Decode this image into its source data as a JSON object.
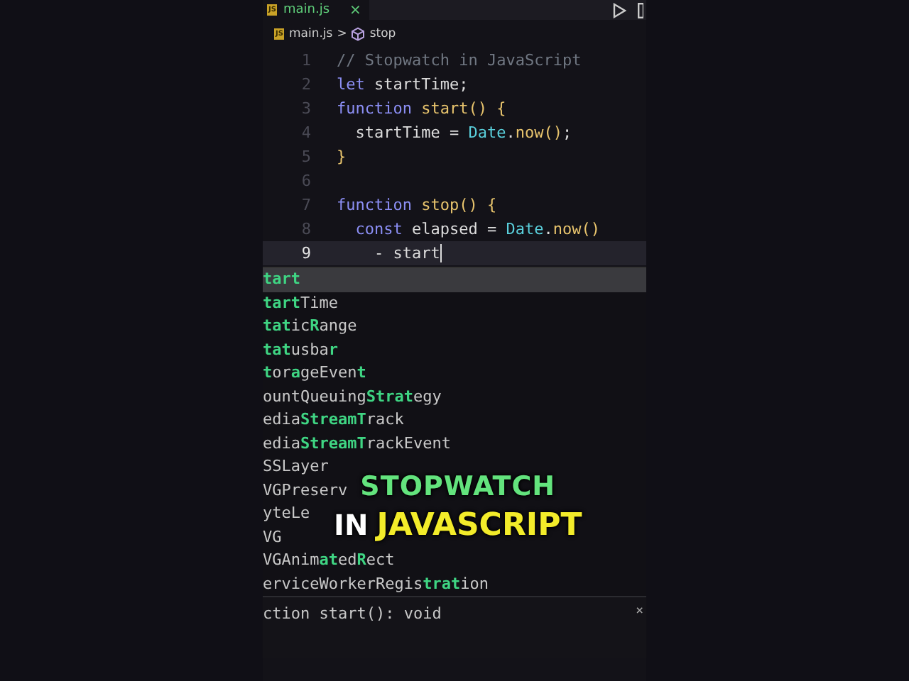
{
  "tab": {
    "filename": "main.js",
    "badge": "JS",
    "close": "×",
    "selected": true
  },
  "breadcrumb": {
    "file": "main.js",
    "badge": "JS",
    "separator": ">",
    "symbol": "stop"
  },
  "code_lines": [
    {
      "number": "1",
      "current": false,
      "tokens": [
        {
          "kind": "comment",
          "text": "// Stopwatch in JavaScript"
        }
      ]
    },
    {
      "number": "2",
      "current": false,
      "tokens": [
        {
          "kind": "keyword",
          "text": "let"
        },
        {
          "kind": "plain",
          "text": " startTime;"
        }
      ]
    },
    {
      "number": "3",
      "current": false,
      "tokens": [
        {
          "kind": "keyword",
          "text": "function"
        },
        {
          "kind": "function",
          "text": " start"
        },
        {
          "kind": "bracket",
          "text": "() {"
        }
      ]
    },
    {
      "number": "4",
      "current": false,
      "tokens": [
        {
          "kind": "plain",
          "text": "  startTime = "
        },
        {
          "kind": "class",
          "text": "Date"
        },
        {
          "kind": "plain",
          "text": "."
        },
        {
          "kind": "function",
          "text": "now"
        },
        {
          "kind": "bracket",
          "text": "()"
        },
        {
          "kind": "plain",
          "text": ";"
        }
      ]
    },
    {
      "number": "5",
      "current": false,
      "tokens": [
        {
          "kind": "bracket",
          "text": "}"
        }
      ]
    },
    {
      "number": "6",
      "current": false
    },
    {
      "number": "7",
      "current": false,
      "tokens": [
        {
          "kind": "keyword",
          "text": "function"
        },
        {
          "kind": "function",
          "text": " stop"
        },
        {
          "kind": "bracket",
          "text": "() {"
        }
      ]
    },
    {
      "number": "8",
      "current": false,
      "tokens": [
        {
          "kind": "keyword",
          "text": "  const"
        },
        {
          "kind": "plain",
          "text": " elapsed = "
        },
        {
          "kind": "class",
          "text": "Date"
        },
        {
          "kind": "plain",
          "text": "."
        },
        {
          "kind": "function",
          "text": "now"
        },
        {
          "kind": "bracket",
          "text": "()"
        }
      ]
    },
    {
      "number": "9",
      "current": true,
      "tokens": [
        {
          "kind": "plain",
          "text": "    - start"
        }
      ]
    }
  ],
  "suggestions": [
    {
      "selected": true,
      "parts": [
        {
          "text": "tart",
          "match": true
        }
      ]
    },
    {
      "selected": false,
      "parts": [
        {
          "text": "tart",
          "match": true
        },
        {
          "text": "Time",
          "match": false
        }
      ]
    },
    {
      "selected": false,
      "parts": [
        {
          "text": "tat",
          "match": true
        },
        {
          "text": "ic",
          "match": false
        },
        {
          "text": "R",
          "match": true
        },
        {
          "text": "ange",
          "match": false
        }
      ]
    },
    {
      "selected": false,
      "parts": [
        {
          "text": "tat",
          "match": true
        },
        {
          "text": "usba",
          "match": false
        },
        {
          "text": "r",
          "match": true
        }
      ]
    },
    {
      "selected": false,
      "parts": [
        {
          "text": "t",
          "match": true
        },
        {
          "text": "or",
          "match": false
        },
        {
          "text": "a",
          "match": true
        },
        {
          "text": "geEven",
          "match": false
        },
        {
          "text": "t",
          "match": true
        }
      ]
    },
    {
      "selected": false,
      "parts": [
        {
          "text": "ountQueuing",
          "match": false
        },
        {
          "text": "Strat",
          "match": true
        },
        {
          "text": "egy",
          "match": false
        }
      ]
    },
    {
      "selected": false,
      "parts": [
        {
          "text": "edia",
          "match": false
        },
        {
          "text": "StreamT",
          "match": true
        },
        {
          "text": "rack",
          "match": false
        }
      ]
    },
    {
      "selected": false,
      "parts": [
        {
          "text": "edia",
          "match": false
        },
        {
          "text": "StreamT",
          "match": true
        },
        {
          "text": "rackEvent",
          "match": false
        }
      ]
    },
    {
      "selected": false,
      "parts": [
        {
          "text": "SSLayer",
          "match": false
        }
      ]
    },
    {
      "selected": false,
      "parts": [
        {
          "text": "VGPreserv",
          "match": false
        }
      ]
    },
    {
      "selected": false,
      "parts": [
        {
          "text": "yteLe",
          "match": false
        }
      ]
    },
    {
      "selected": false,
      "parts": [
        {
          "text": "VG",
          "match": false
        }
      ]
    },
    {
      "selected": false,
      "parts": [
        {
          "text": "VGAnim",
          "match": false
        },
        {
          "text": "at",
          "match": true
        },
        {
          "text": "ed",
          "match": false
        },
        {
          "text": "R",
          "match": true
        },
        {
          "text": "ect",
          "match": false
        }
      ]
    },
    {
      "selected": false,
      "parts": [
        {
          "text": "erviceWorkerRegis",
          "match": false
        },
        {
          "text": "trat",
          "match": true
        },
        {
          "text": "ion",
          "match": false
        }
      ]
    }
  ],
  "detail": {
    "signature": "ction start(): void",
    "close": "×"
  },
  "caption": {
    "line_1": "STOPWATCH",
    "line_2_lead": "IN",
    "line_2": "JAVASCRIPT"
  }
}
